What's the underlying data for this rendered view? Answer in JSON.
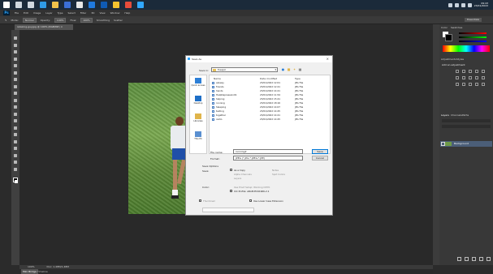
{
  "taskbar": {
    "icons": [
      {
        "name": "windows-start-icon",
        "color": "#ffffff"
      },
      {
        "name": "search-icon",
        "color": "#d0d8e0"
      },
      {
        "name": "task-view-icon",
        "color": "#d0d8e0"
      },
      {
        "name": "edge-icon",
        "color": "#2f9be8"
      },
      {
        "name": "file-explorer-icon",
        "color": "#f0c24b"
      },
      {
        "name": "app-icon-1",
        "color": "#3b6fd6"
      },
      {
        "name": "app-icon-2",
        "color": "#e8e8e8"
      },
      {
        "name": "app-icon-3",
        "color": "#1f7ae0"
      },
      {
        "name": "app-icon-4",
        "color": "#0f5bb5"
      },
      {
        "name": "chrome-icon",
        "color": "#f2c230"
      },
      {
        "name": "chrome-icon-2",
        "color": "#e44c3b"
      },
      {
        "name": "photoshop-taskbar-icon",
        "color": "#31a8ff"
      }
    ],
    "clock_time": "09:43",
    "clock_date": "23/01/2022"
  },
  "menubar": {
    "logo": "Ps",
    "items": [
      "File",
      "Edit",
      "Image",
      "Layer",
      "Type",
      "Select",
      "Filter",
      "3D",
      "View",
      "Window",
      "Help"
    ]
  },
  "optbar": {
    "items": [
      "Mode:",
      "Normal",
      "Opacity:",
      "100%",
      "Flow:",
      "100%",
      "Smoothing",
      "Scatter"
    ],
    "workspace": "Essentials"
  },
  "document_tab": "relaxing-guy.jpg @ 100% (RGB/8#) ×",
  "status": {
    "zoom": "100%",
    "doc_size": "Doc: 1.48M/1.48M"
  },
  "bottom_tabs": [
    "Mini Bridge",
    "Timeline"
  ],
  "right_panel": {
    "tabs": [
      "Color",
      "Swatches"
    ],
    "adjustments_tabs": [
      "Adjustments",
      "Styles"
    ],
    "adjustments_hint": "Add an adjustment",
    "layers_tabs": [
      "Layers",
      "Channels",
      "Paths"
    ],
    "layer_name": "Background"
  },
  "dialog": {
    "title": "Save As",
    "close": "×",
    "save_in_label": "Save in:",
    "save_in_value": "freepic",
    "places": [
      {
        "label": "Quick access",
        "icon": "star-icon",
        "color": "#2d7fd6"
      },
      {
        "label": "Desktop",
        "icon": "desktop-icon",
        "color": "#1e6fc7"
      },
      {
        "label": "Libraries",
        "icon": "libraries-icon",
        "color": "#e0b44a"
      },
      {
        "label": "This PC",
        "icon": "computer-icon",
        "color": "#5a8fd0"
      }
    ],
    "columns": [
      "Name",
      "Date modified",
      "Type"
    ],
    "files": [
      {
        "name": "aloway",
        "date": "23/01/2022 12:01",
        "type": "JPG File"
      },
      {
        "name": "friends",
        "date": "23/01/2022 12:21",
        "type": "JPG File"
      },
      {
        "name": "hands",
        "date": "23/01/2022 14:21",
        "type": "JPG File"
      },
      {
        "name": "HelpDepression01",
        "date": "23/01/2022 11:54",
        "type": "JPG File"
      },
      {
        "name": "helping",
        "date": "23/01/2022 15:41",
        "type": "JPG File"
      },
      {
        "name": "running",
        "date": "23/01/2022 18:16",
        "type": "JPG File"
      },
      {
        "name": "Sleeping",
        "date": "23/01/2022 14:07",
        "type": "JPG File"
      },
      {
        "name": "texting",
        "date": "23/01/2022 14:25",
        "type": "JPG File"
      },
      {
        "name": "together",
        "date": "23/01/2022 14:21",
        "type": "JPG File"
      },
      {
        "name": "cadio",
        "date": "23/01/2022 14:25",
        "type": "JPG File"
      }
    ],
    "file_name_label": "File name:",
    "file_name_value": "running2",
    "format_label": "Format:",
    "format_value": "JPEG (*.JPG;*.JPEG;*.JPE)",
    "save_button": "Save",
    "cancel_button": "Cancel",
    "save_options_label": "Save Options",
    "save_label": "Save:",
    "as_a_copy": "As a Copy",
    "notes": "Notes",
    "alpha_channels": "Alpha Channels",
    "spot_colors": "Spot Colors",
    "layers": "Layers",
    "color_label": "Color:",
    "use_proof_setup": "Use Proof Setup: Working CMYK",
    "icc_profile": "ICC Profile: sRGB IEC61966-2.1",
    "thumbnail": "Thumbnail",
    "use_lower_case": "Use Lower Case Extension"
  }
}
